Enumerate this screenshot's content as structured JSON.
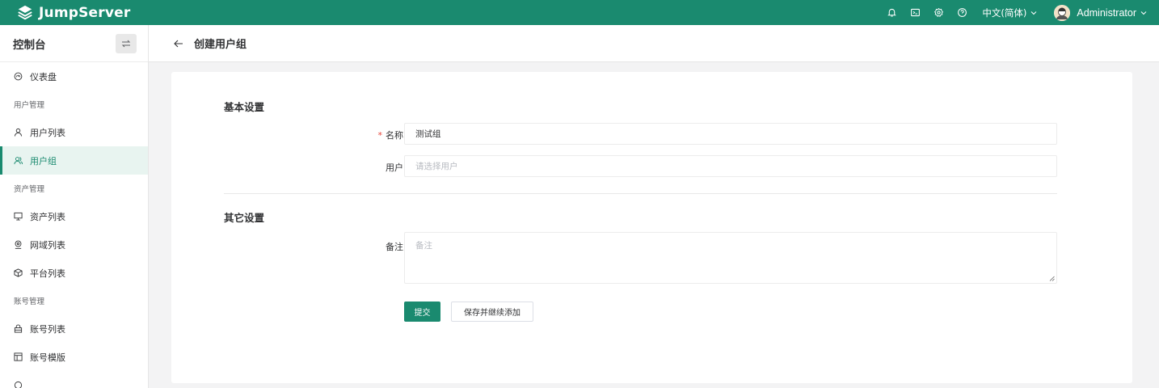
{
  "header": {
    "brand": "JumpServer",
    "language": "中文(简体)",
    "user_name": "Administrator",
    "icons": [
      "bell-icon",
      "terminal-icon",
      "settings-icon",
      "help-icon"
    ]
  },
  "sidebar": {
    "title": "控制台",
    "items": [
      {
        "type": "item",
        "label": "仪表盘",
        "icon": "dashboard-icon"
      },
      {
        "type": "group",
        "label": "用户管理"
      },
      {
        "type": "item",
        "label": "用户列表",
        "icon": "user-icon"
      },
      {
        "type": "item",
        "label": "用户组",
        "icon": "user-group-icon",
        "active": true
      },
      {
        "type": "group",
        "label": "资产管理"
      },
      {
        "type": "item",
        "label": "资产列表",
        "icon": "monitor-icon"
      },
      {
        "type": "item",
        "label": "网域列表",
        "icon": "location-icon"
      },
      {
        "type": "item",
        "label": "平台列表",
        "icon": "cube-icon"
      },
      {
        "type": "group",
        "label": "账号管理"
      },
      {
        "type": "item",
        "label": "账号列表",
        "icon": "lock-icon"
      },
      {
        "type": "item",
        "label": "账号模版",
        "icon": "template-icon"
      }
    ]
  },
  "page": {
    "title": "创建用户组"
  },
  "form": {
    "basic_section": "基本设置",
    "name_label": "名称",
    "name_value": "测试组",
    "users_label": "用户",
    "users_placeholder": "请选择用户",
    "other_section": "其它设置",
    "comment_label": "备注",
    "comment_placeholder": "备注",
    "submit_label": "提交",
    "save_continue_label": "保存并继续添加"
  },
  "colors": {
    "brand": "#1a8a6f",
    "active_bg": "#e8f4f0",
    "required": "#e6463b"
  }
}
